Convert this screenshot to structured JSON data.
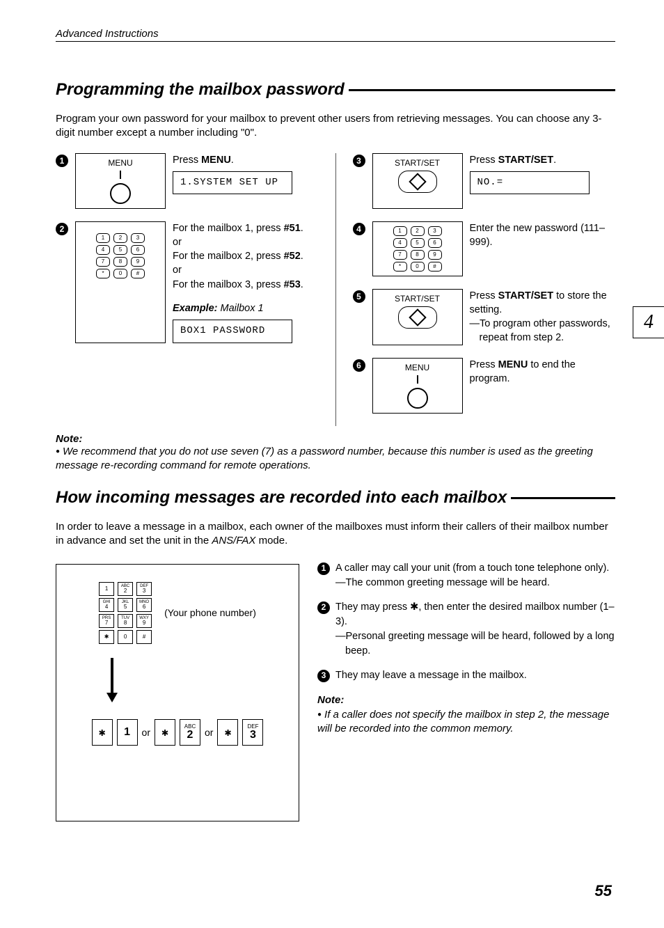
{
  "header": "Advanced Instructions",
  "chapter_tab": "4",
  "page_number": "55",
  "section1": {
    "title": "Programming the mailbox password",
    "intro": "Program your own password for your mailbox to prevent other users from retrieving messages. You can choose any 3-digit number except a number including \"0\".",
    "steps": {
      "s1": {
        "panel_label": "MENU",
        "desc_prefix": "Press ",
        "desc_bold": "MENU",
        "desc_suffix": ".",
        "lcd": "1.SYSTEM SET UP"
      },
      "s2": {
        "line1a": "For the mailbox 1, press ",
        "line1b": "#51",
        "line1c": ".",
        "or1": "or",
        "line2a": "For the mailbox 2, press ",
        "line2b": "#52",
        "line2c": ".",
        "or2": "or",
        "line3a": "For the mailbox 3, press ",
        "line3b": "#53",
        "line3c": ".",
        "example_label": "Example:",
        "example_text": " Mailbox 1",
        "lcd": "BOX1 PASSWORD"
      },
      "s3": {
        "panel_label": "START/SET",
        "desc_prefix": "Press ",
        "desc_bold": "START/SET",
        "desc_suffix": ".",
        "lcd": "NO.="
      },
      "s4": {
        "desc": "Enter the new password (111–999)."
      },
      "s5": {
        "panel_label": "START/SET",
        "desc_prefix": "Press ",
        "desc_bold": "START/SET",
        "desc_suffix": " to store the setting.",
        "sub": "To program other passwords, repeat from step 2."
      },
      "s6": {
        "panel_label": "MENU",
        "desc_prefix": "Press ",
        "desc_bold": "MENU",
        "desc_suffix": " to end the program."
      }
    },
    "note_label": "Note:",
    "note_body": "We recommend that you do not use seven (7) as a password number, because this number is used as the greeting message re-recording command for remote operations."
  },
  "section2": {
    "title": "How incoming messages are recorded into each mailbox",
    "intro_a": "In order to leave a message in a mailbox, each owner of the mailboxes must inform their callers of their mailbox number in advance and set the unit in the ",
    "intro_mode": "ANS/FAX",
    "intro_b": " mode.",
    "illus": {
      "phone_caption": "(Your phone number)",
      "or": "or",
      "keys": {
        "star": "✱",
        "k1": "1",
        "k2sup": "ABC",
        "k2": "2",
        "k3sup": "DEF",
        "k3": "3"
      }
    },
    "list": {
      "i1": {
        "text": "A caller may call your unit (from a touch tone telephone only).",
        "sub": "The common greeting message will be heard."
      },
      "i2": {
        "text": "They may press ✱, then enter the desired mailbox number (1–3).",
        "sub": "Personal greeting message will be heard, followed by a long beep."
      },
      "i3": {
        "text": "They may leave a message in the mailbox."
      }
    },
    "note_label": "Note:",
    "note_body": "If a caller does not specify the mailbox in step 2, the message will be recorded into the common memory."
  }
}
